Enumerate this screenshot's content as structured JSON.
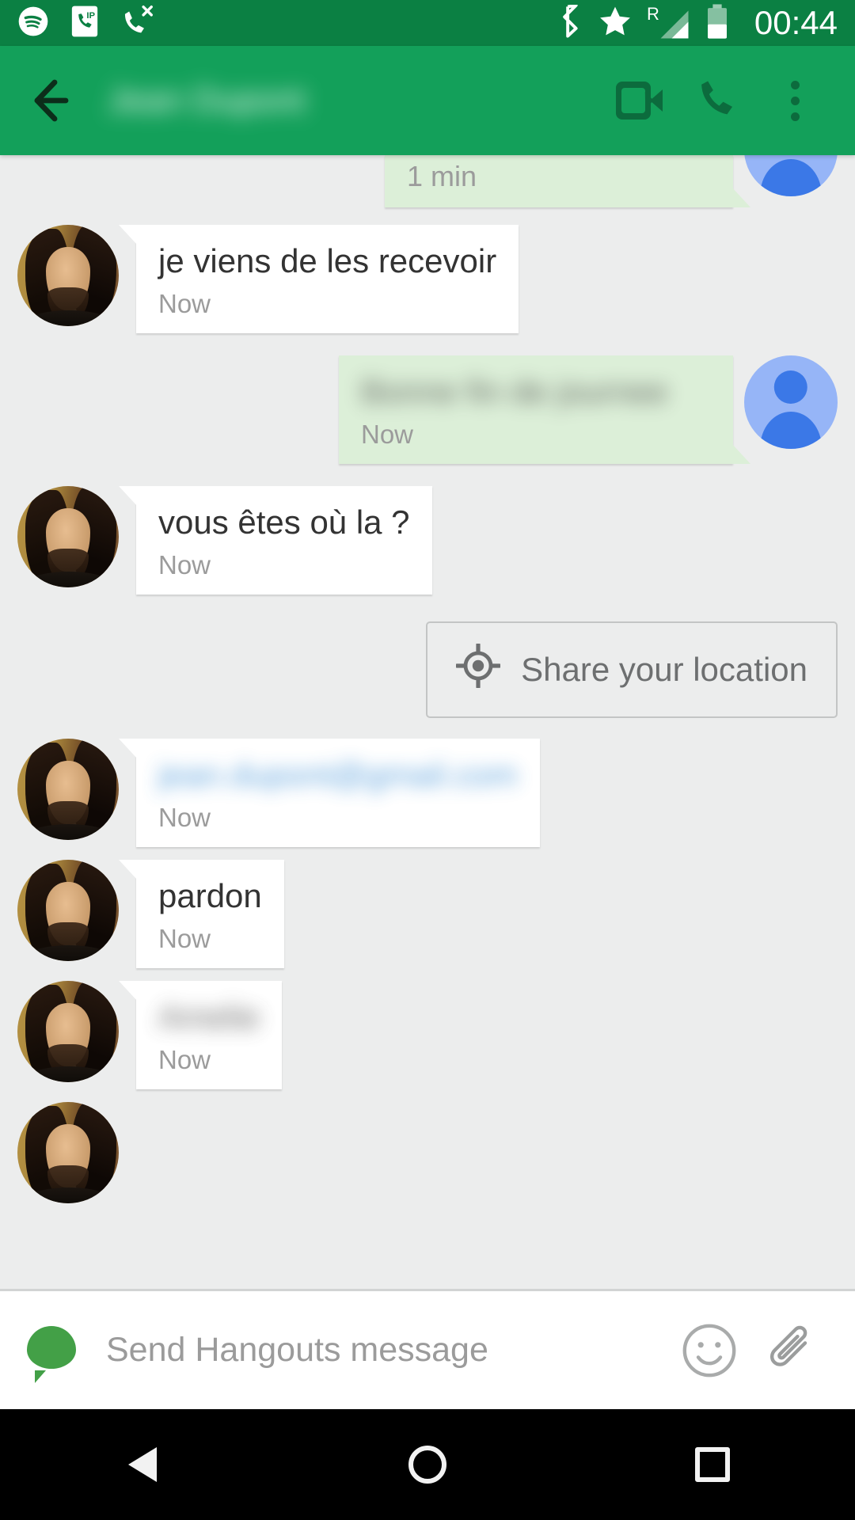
{
  "status_bar": {
    "icons": [
      "spotify-icon",
      "sip-phone-icon",
      "missed-call-icon"
    ],
    "right_icons": [
      "bluetooth-icon",
      "star-priority-icon",
      "roaming-signal-icon",
      "battery-icon"
    ],
    "roaming_label": "R",
    "clock": "00:44",
    "background_color": "#0b8043",
    "foreground_color": "#ffffff"
  },
  "app_bar": {
    "background_color": "#13a05a",
    "icon_color": "#0c6b3d",
    "back_label": "Back",
    "contact_name": "Jean Dupont",
    "contact_name_redacted": true,
    "actions": [
      {
        "name": "video-call-icon",
        "label": "Video call"
      },
      {
        "name": "voice-call-icon",
        "label": "Call"
      },
      {
        "name": "overflow-menu-icon",
        "label": "More options"
      }
    ]
  },
  "conversation": {
    "background_color": "#eceded",
    "incoming_bubble_color": "#ffffff",
    "outgoing_bubble_color": "#dcefd8",
    "messages": [
      {
        "direction": "out",
        "text": "",
        "time": "1 min",
        "partial": true,
        "redacted": false,
        "avatar": "generic-blue-avatar"
      },
      {
        "direction": "in",
        "text": "je viens de les recevoir",
        "time": "Now",
        "redacted": false,
        "avatar": "contact-photo-avatar"
      },
      {
        "direction": "out",
        "text": "Bonne fin de journee",
        "time": "Now",
        "redacted": true,
        "avatar": "generic-blue-avatar"
      },
      {
        "direction": "in",
        "text": "vous êtes où la ?",
        "time": "Now",
        "redacted": false,
        "avatar": "contact-photo-avatar"
      },
      {
        "direction": "in",
        "text": "jean.dupont@gmail.com",
        "time": "Now",
        "redacted": true,
        "is_link": true,
        "avatar": "contact-photo-avatar"
      },
      {
        "direction": "in",
        "text": "pardon",
        "time": "Now",
        "redacted": false,
        "avatar": "contact-photo-avatar"
      },
      {
        "direction": "in",
        "text": "Amelie",
        "time": "Now",
        "redacted": true,
        "avatar": "contact-photo-avatar"
      }
    ],
    "suggestion_chip": {
      "label": "Share your location",
      "icon": "gps-crosshair-icon",
      "border_color": "#c3c5c5",
      "text_color": "#6d6f70"
    },
    "trailing_avatar": "contact-photo-avatar"
  },
  "composer": {
    "account_icon": "green-message-bubble-icon",
    "account_icon_color": "#43a047",
    "placeholder": "Send Hangouts message",
    "value": "",
    "actions": [
      {
        "name": "emoji-icon",
        "label": "Insert emoji"
      },
      {
        "name": "attach-paperclip-icon",
        "label": "Attach"
      }
    ]
  },
  "nav_bar": {
    "background_color": "#000000",
    "buttons": [
      {
        "name": "nav-back-button",
        "label": "Back"
      },
      {
        "name": "nav-home-button",
        "label": "Home"
      },
      {
        "name": "nav-recents-button",
        "label": "Recents"
      }
    ]
  }
}
